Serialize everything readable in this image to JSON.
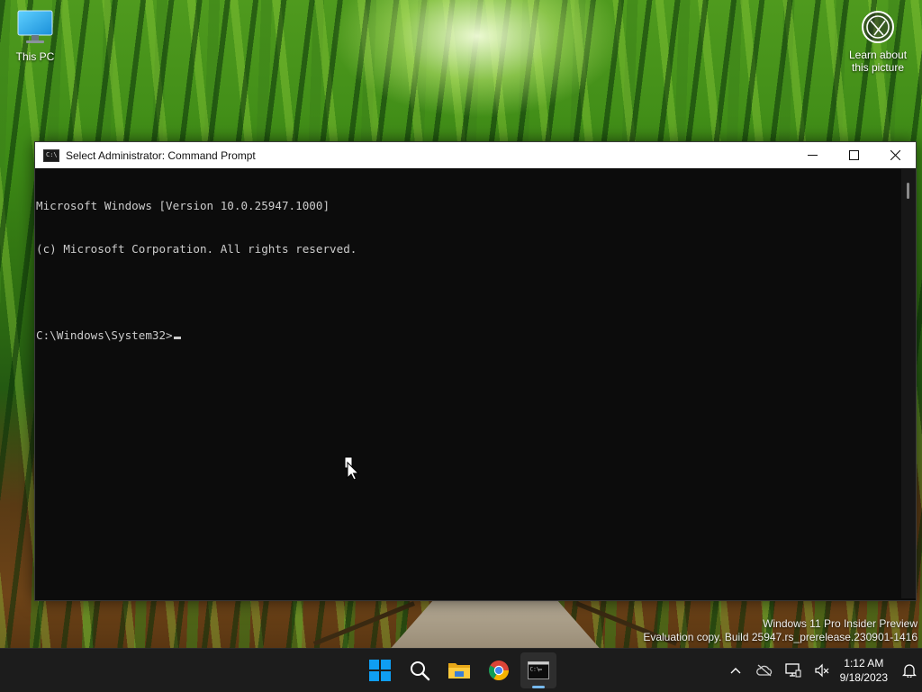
{
  "desktop": {
    "icons": [
      {
        "label": "This PC"
      },
      {
        "label": "Learn about this picture"
      }
    ],
    "watermark": {
      "line1": "Windows 11 Pro Insider Preview",
      "line2": "Evaluation copy. Build 25947.rs_prerelease.230901-1416"
    }
  },
  "window": {
    "title": "Select Administrator: Command Prompt",
    "icon_text": "C:\\",
    "console_lines": [
      "Microsoft Windows [Version 10.0.25947.1000]",
      "(c) Microsoft Corporation. All rights reserved.",
      "",
      "C:\\Windows\\System32>"
    ]
  },
  "taskbar": {
    "apps": [
      "windows-start",
      "search",
      "file-explorer",
      "chrome",
      "command-prompt"
    ],
    "clock": {
      "time": "1:12 AM",
      "date": "9/18/2023"
    }
  },
  "colors": {
    "console_bg": "#0c0c0c",
    "console_fg": "#cccccc",
    "taskbar_bg": "#1c1c1c",
    "start_blue": "#0f9ef2"
  }
}
